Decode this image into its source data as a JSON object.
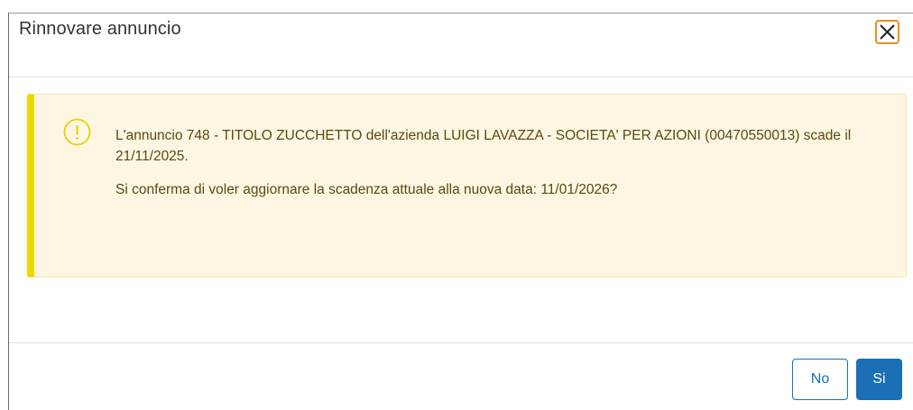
{
  "dialog": {
    "title": "Rinnovare annuncio",
    "close_icon": "close-icon"
  },
  "alert": {
    "icon": "warning-circle-icon",
    "line1": "L'annuncio 748 - TITOLO ZUCCHETTO dell'azienda LUIGI LAVAZZA - SOCIETA' PER AZIONI (00470550013) scade il 21/11/2025.",
    "line2": "Si conferma di voler aggiornare la scadenza attuale alla nuova data: 11/01/2026?"
  },
  "footer": {
    "no_label": "No",
    "si_label": "Si"
  },
  "colors": {
    "primary": "#1a6fb5",
    "alert_bg": "#fdf6e3",
    "alert_accent": "#f2d500",
    "focus_outline": "#f08a24"
  }
}
